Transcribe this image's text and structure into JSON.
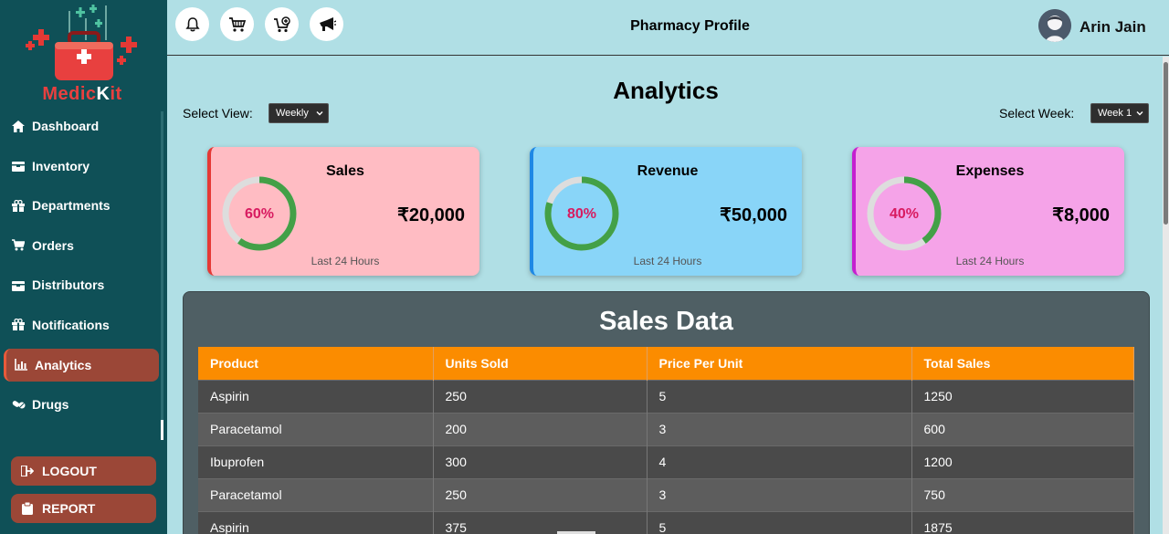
{
  "brand": {
    "name_part1": "Medic",
    "name_part2": "K",
    "name_part3": "it"
  },
  "sidebar": {
    "items": [
      {
        "label": "Dashboard",
        "icon": "home-icon"
      },
      {
        "label": "Inventory",
        "icon": "box-icon"
      },
      {
        "label": "Departments",
        "icon": "gift-icon"
      },
      {
        "label": "Orders",
        "icon": "cart-icon"
      },
      {
        "label": "Distributors",
        "icon": "box-icon"
      },
      {
        "label": "Notifications",
        "icon": "gift-icon"
      },
      {
        "label": "Analytics",
        "icon": "chart-icon",
        "active": true
      },
      {
        "label": "Drugs",
        "icon": "pills-icon"
      }
    ],
    "logout_label": "LOGOUT",
    "report_label": "REPORT"
  },
  "topbar": {
    "title": "Pharmacy Profile",
    "user_name": "Arin Jain",
    "icons": [
      "bell-icon",
      "cart-icon",
      "cart-add-icon",
      "megaphone-icon"
    ]
  },
  "analytics": {
    "heading": "Analytics",
    "view_label": "Select View:",
    "view_value": "Weekly",
    "week_label": "Select Week:",
    "week_value": "Week 1"
  },
  "cards": [
    {
      "title": "Sales",
      "percent": 60,
      "percent_text": "60%",
      "amount": "₹20,000",
      "subtitle": "Last 24 Hours",
      "bg": "#ffbcc3",
      "accent": "#e53935"
    },
    {
      "title": "Revenue",
      "percent": 80,
      "percent_text": "80%",
      "amount": "₹50,000",
      "subtitle": "Last 24 Hours",
      "bg": "#89d5f8",
      "accent": "#1e88e5"
    },
    {
      "title": "Expenses",
      "percent": 40,
      "percent_text": "40%",
      "amount": "₹8,000",
      "subtitle": "Last 24 Hours",
      "bg": "#f5a3e8",
      "accent": "#c51fd0"
    }
  ],
  "colors": {
    "ring_fill": "#43a047",
    "ring_track": "#dddddd",
    "percent_text": "#d81b60",
    "table_header": "#fb8c00"
  },
  "sales_data": {
    "title": "Sales Data",
    "columns": [
      "Product",
      "Units Sold",
      "Price Per Unit",
      "Total Sales"
    ],
    "rows": [
      [
        "Aspirin",
        "250",
        "5",
        "1250"
      ],
      [
        "Paracetamol",
        "200",
        "3",
        "600"
      ],
      [
        "Ibuprofen",
        "300",
        "4",
        "1200"
      ],
      [
        "Paracetamol",
        "250",
        "3",
        "750"
      ],
      [
        "Aspirin",
        "375",
        "5",
        "1875"
      ]
    ]
  }
}
